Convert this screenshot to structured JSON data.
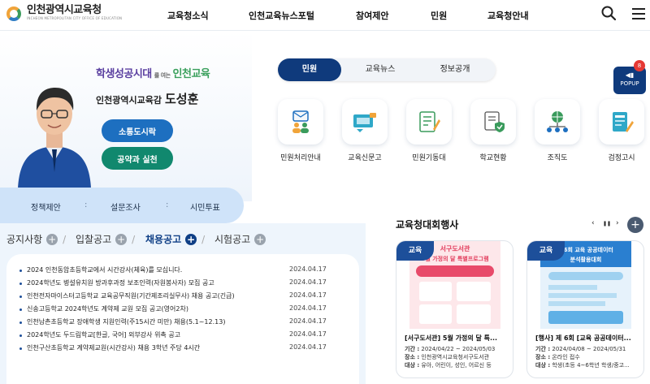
{
  "header": {
    "logo_title": "인천광역시교육청",
    "logo_sub": "INCHEON METROPOLITAN CITY OFFICE OF EDUCATION",
    "nav": [
      "교육청소식",
      "인천교육뉴스포털",
      "참여제안",
      "민원",
      "교육청안내"
    ],
    "search_icon": "search-icon",
    "menu_icon": "hamburger-menu-icon"
  },
  "hero": {
    "slogan_a": "학생성공시대",
    "slogan_mid": "를 여는",
    "slogan_b": "인천교육",
    "superintendent_role": "인천광역시교육감",
    "superintendent_name": "도성훈",
    "btn_communication": "소통도시락",
    "btn_pledge": "공약과 실천"
  },
  "quickbar": [
    "정책제안",
    "설문조사",
    "시민투표"
  ],
  "notice": {
    "tabs": [
      "공지사항",
      "입찰공고",
      "채용공고",
      "시험공고"
    ],
    "active_tab": 2,
    "items": [
      {
        "title": "2024 인천동암초등학교에서 시간강사(체육)를 모십니다.",
        "date": "2024.04.17"
      },
      {
        "title": "2024학년도 병설유치원 방과후과정 보조인력(자원봉사자) 모집 공고",
        "date": "2024.04.17"
      },
      {
        "title": "인천전자마이스터고등학교 교육공무직원(기간제조리실무사) 채용 공고(긴급)",
        "date": "2024.04.17"
      },
      {
        "title": "신송고등학교 2024학년도 계약제 교원 모집 공고(영어2차)",
        "date": "2024.04.17"
      },
      {
        "title": "인천남촌초등학교 장애학생 지원인력(주15시간 미만) 채용(5.1~12.13)",
        "date": "2024.04.17"
      },
      {
        "title": "2024학년도 두드림학교[한글, 국어] 외부강사 위촉 공고",
        "date": "2024.04.17"
      },
      {
        "title": "인천구산초등학교 계약제교원(시간강사) 채용 3학년 주당 4시간",
        "date": "2024.04.17"
      }
    ]
  },
  "service_tabs": [
    "민원",
    "교육뉴스",
    "정보공개"
  ],
  "popup": {
    "label": "POPUP",
    "count": "8"
  },
  "services": [
    {
      "label": "민원처리안내",
      "icon": "civil-guide-icon"
    },
    {
      "label": "교육신문고",
      "icon": "education-petition-icon"
    },
    {
      "label": "민원기동대",
      "icon": "civil-task-force-icon"
    },
    {
      "label": "학교현황",
      "icon": "school-status-icon"
    },
    {
      "label": "조직도",
      "icon": "org-chart-icon"
    },
    {
      "label": "검정고시",
      "icon": "qualification-exam-icon"
    }
  ],
  "events": {
    "title": "교육청대회행사",
    "controls": [
      "‹",
      "❚❚",
      "›"
    ],
    "cards": [
      {
        "tag": "교육",
        "thumb_text": "서구도서관 5월 가정의 달 특별프로그램",
        "title": "[서구도서관] 5월 가정의 달 특...",
        "period_label": "기간 :",
        "period": "2024/04/22 ~ 2024/05/03",
        "place_label": "장소 :",
        "place": "인천광역시교육청서구도서관",
        "target_label": "대상 :",
        "target": "유아, 어린이, 성인, 어르신 등"
      },
      {
        "tag": "교육",
        "thumb_text": "제6회 교육 공공데이터 분석활용대회",
        "title": "[행사] 제 6회 [교육 공공데이터...",
        "period_label": "기간 :",
        "period": "2024/04/08 ~ 2024/05/31",
        "place_label": "장소 :",
        "place": "온라인 접수",
        "target_label": "대상 :",
        "target": "학생(초등 4~6학년 학생/중고..."
      }
    ]
  },
  "colors": {
    "navy": "#0f3a7c",
    "blue": "#1d6fc0",
    "green": "#11886e",
    "quickbar": "#cfe3f9"
  }
}
